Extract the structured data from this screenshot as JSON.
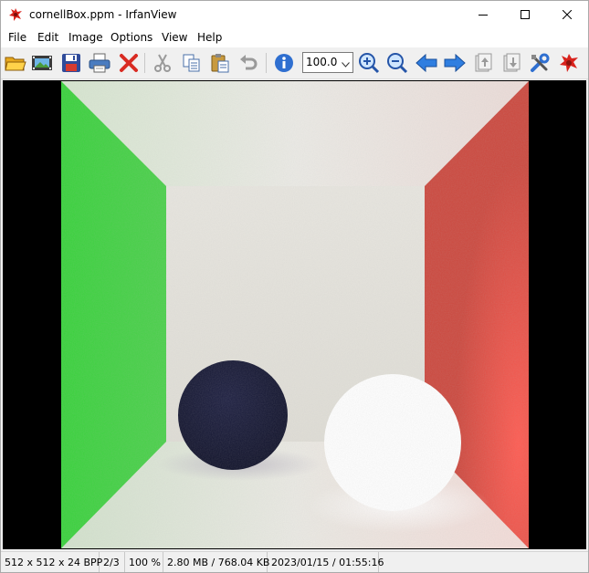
{
  "window": {
    "title": "cornellBox.ppm - IrfanView",
    "icon": "irfanview-red-splat-icon"
  },
  "menu": {
    "items": [
      "File",
      "Edit",
      "Image",
      "Options",
      "View",
      "Help"
    ]
  },
  "toolbar": {
    "zoom_value": "100.0",
    "buttons": [
      "open-folder-icon",
      "slideshow-icon",
      "save-floppy-icon",
      "print-icon",
      "delete-x-icon",
      "cut-scissors-icon",
      "copy-icon",
      "paste-clipboard-icon",
      "undo-icon",
      "info-icon",
      "zoom-in-icon",
      "zoom-out-icon",
      "previous-arrow-icon",
      "next-arrow-icon",
      "first-page-icon",
      "last-page-icon",
      "settings-tools-icon",
      "irfanview-about-icon"
    ]
  },
  "image": {
    "name": "cornellBox.ppm",
    "colors": {
      "left_wall": "#3cd43c",
      "right_wall": "#e04a40",
      "back_wall": "#e3e1da",
      "dark_sphere": "#141633",
      "light_sphere": "#ffffff"
    }
  },
  "status": {
    "dimensions": "512 x 512 x 24 BPP",
    "page": "2/3",
    "zoom": "100 %",
    "size": "2.80 MB / 768.04 KB",
    "datetime": "2023/01/15 / 01:55:16"
  }
}
